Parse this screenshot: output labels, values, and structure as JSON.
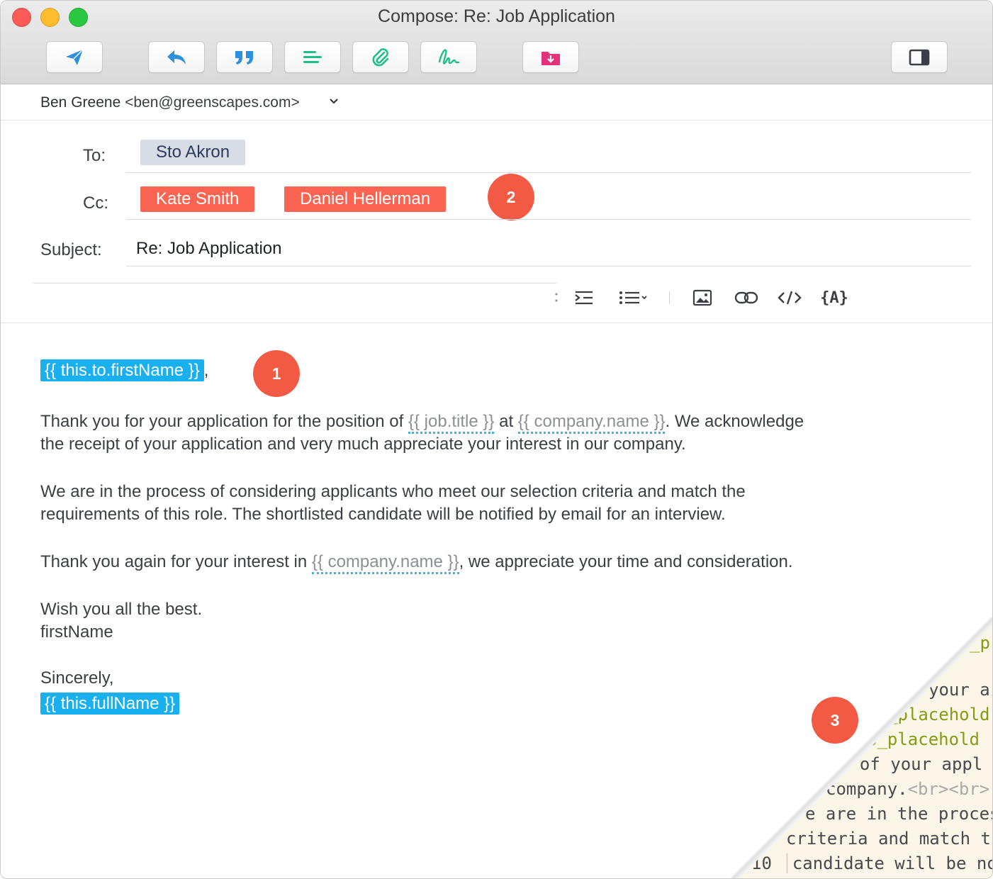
{
  "window": {
    "title": "Compose: Re: Job Application"
  },
  "from": {
    "name": "Ben Greene",
    "email": "<ben@greenscapes.com>"
  },
  "to": {
    "label": "To:",
    "recipients": [
      "Sto Akron"
    ]
  },
  "cc": {
    "label": "Cc:",
    "recipients": [
      "Kate Smith",
      "Daniel Hellerman"
    ]
  },
  "subject": {
    "label": "Subject:",
    "value": "Re: Job Application"
  },
  "badges": [
    "1",
    "2",
    "3"
  ],
  "icons": {
    "send": "send-icon",
    "reply": "reply-icon",
    "quote": "quote-icon",
    "template": "template-icon",
    "attach": "paperclip-icon",
    "signature": "signature-icon",
    "save": "download-folder-icon",
    "sidebar": "sidebar-toggle-icon"
  },
  "body": {
    "greeting_placeholder": "{{ this.to.firstName }}",
    "greeting_suffix": ",",
    "p1_a": "Thank you for your application for the position of ",
    "p1_var1": "{{ job.title }}",
    "p1_b": " at ",
    "p1_var2": "{{ company.name }}",
    "p1_c": ". We acknowledge",
    "p1_line2": "the receipt of your application and very much appreciate your interest in our company.",
    "p2_line1": "We are in the process of considering applicants who meet our selection criteria and match the",
    "p2_line2": "requirements of this role. The shortlisted candidate will be notified by email for an interview.",
    "p3_a": "Thank you again for your interest in ",
    "p3_var": "{{ company.name }}",
    "p3_b": ", we appreciate your time and consideration.",
    "wish": "Wish you all the best.",
    "first_name": "firstName",
    "sincerely": "Sincerely,",
    "signature_placeholder": "{{ this.fullName }}"
  },
  "code_peek": {
    "lines": [
      "_p",
      "your a",
      "_placehold",
      "b_placehold",
      "t of your appl",
      "company.",
      "<br><br>",
      "e are in the proces",
      "criteria and match t",
      "candidate will be no"
    ],
    "line_number": "10"
  },
  "colors": {
    "placeholder_bg": "#19b0f0",
    "cc_chip": "#fa6453",
    "to_chip": "#d8dce4",
    "badge": "#f25a44",
    "icon_blue": "#2d8fe0",
    "icon_green": "#1dbf8a",
    "icon_pink": "#e5317a"
  }
}
